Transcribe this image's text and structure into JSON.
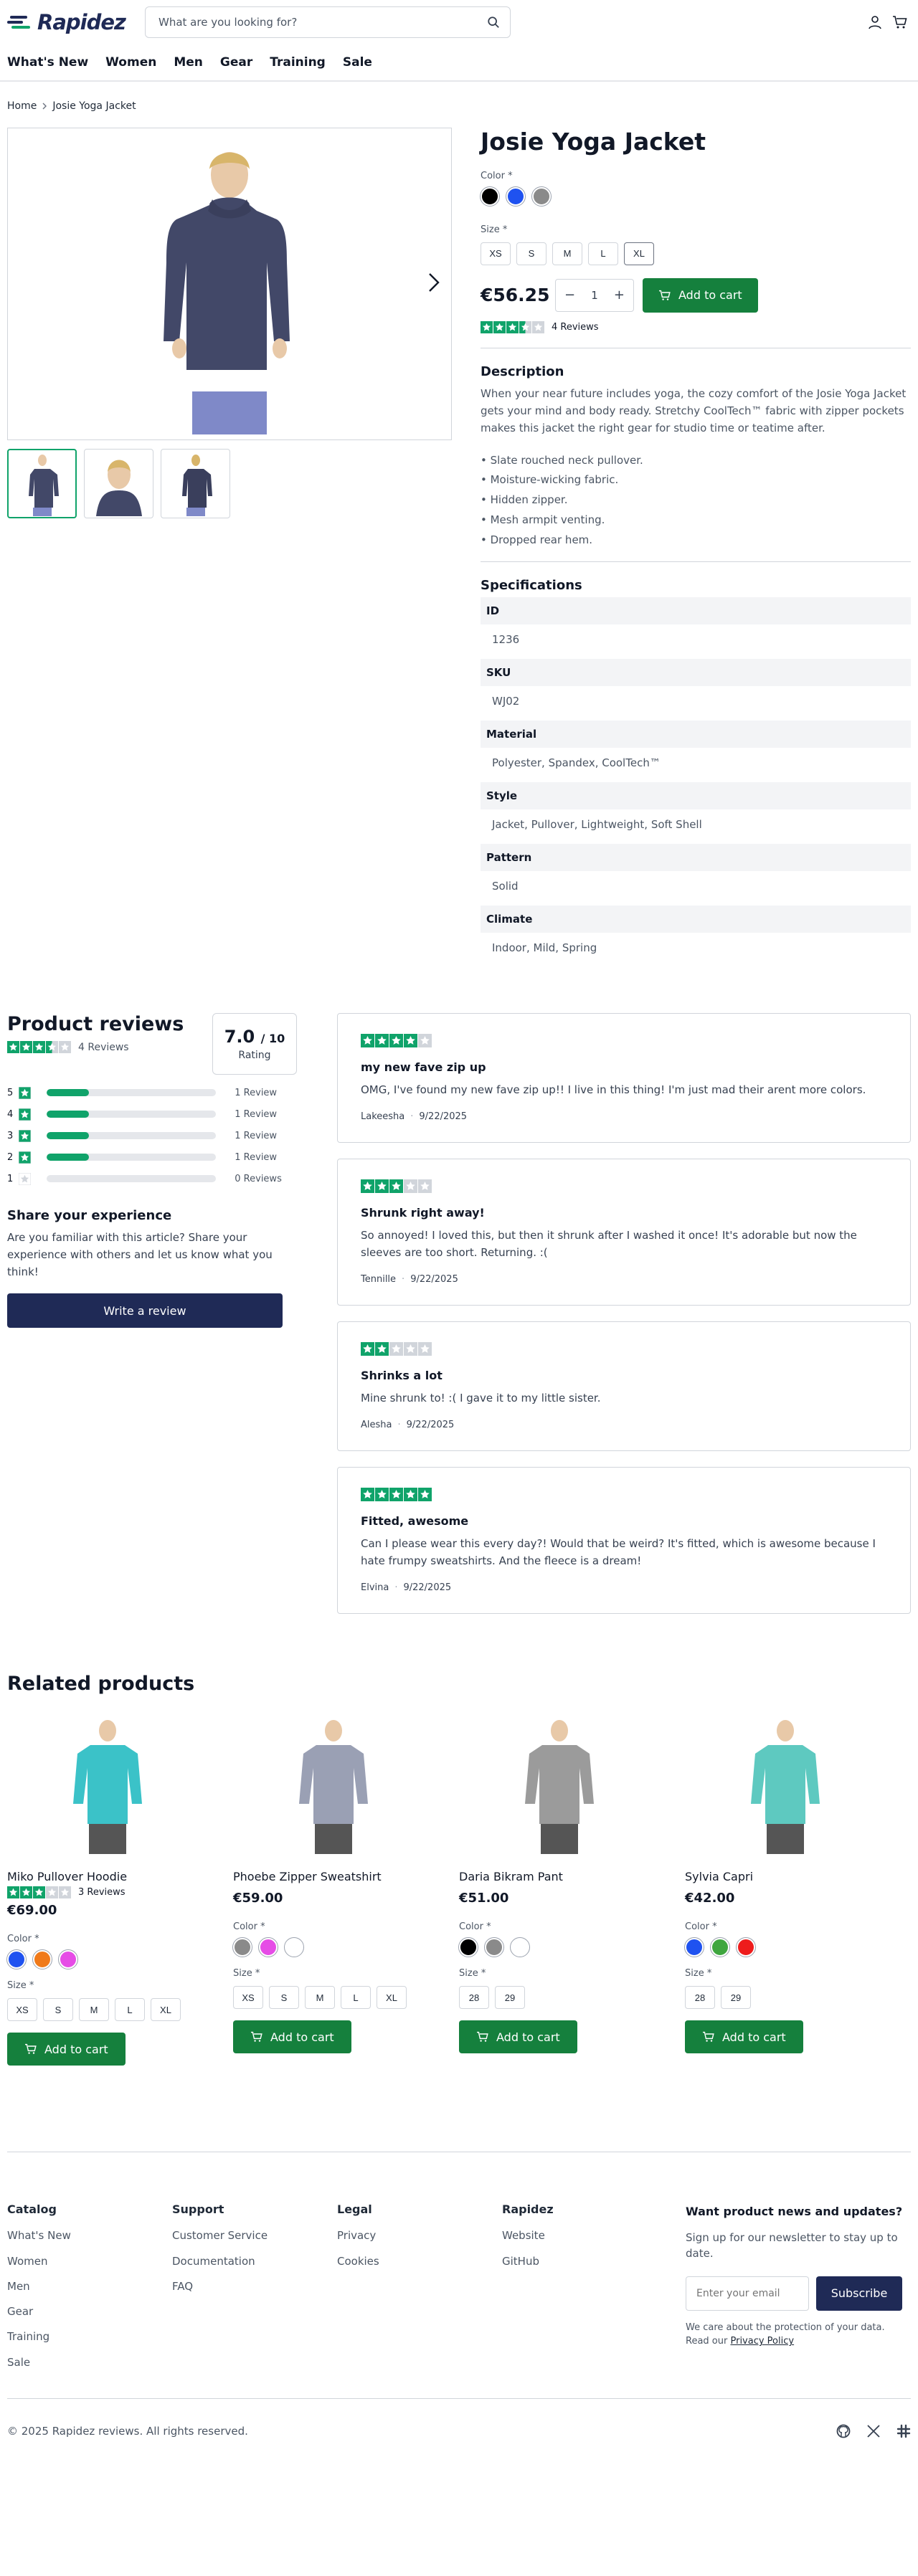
{
  "header": {
    "logo": "Rapidez",
    "search_placeholder": "What are you looking for?",
    "nav": [
      "What's New",
      "Women",
      "Men",
      "Gear",
      "Training",
      "Sale"
    ]
  },
  "breadcrumb": {
    "home": "Home",
    "current": "Josie Yoga Jacket"
  },
  "product": {
    "title": "Josie Yoga Jacket",
    "color_label": "Color *",
    "colors": [
      "#000000",
      "#1f52f0",
      "#8a8a8a"
    ],
    "size_label": "Size *",
    "sizes": [
      "XS",
      "S",
      "M",
      "L",
      "XL"
    ],
    "price": "€56.25",
    "qty": "1",
    "add_to_cart": "Add to cart",
    "rating": 3.5,
    "review_count": "4 Reviews",
    "desc_heading": "Description",
    "description": "When your near future includes yoga, the cozy comfort of the Josie Yoga Jacket gets your mind and body ready. Stretchy CoolTech™ fabric with zipper pockets makes this jacket the right gear for studio time or teatime after.",
    "bullets": [
      "• Slate rouched neck pullover.",
      "• Moisture-wicking fabric.",
      "• Hidden zipper.",
      "• Mesh armpit venting.",
      "• Dropped rear hem."
    ],
    "spec_heading": "Specifications",
    "specs": [
      {
        "k": "ID",
        "v": "1236"
      },
      {
        "k": "SKU",
        "v": "WJ02"
      },
      {
        "k": "Material",
        "v": "Polyester, Spandex, CoolTech™"
      },
      {
        "k": "Style",
        "v": "Jacket, Pullover, Lightweight, Soft Shell"
      },
      {
        "k": "Pattern",
        "v": "Solid"
      },
      {
        "k": "Climate",
        "v": "Indoor, Mild, Spring"
      }
    ]
  },
  "reviews": {
    "heading": "Product reviews",
    "count": "4 Reviews",
    "score": "7.0",
    "score_max": "/ 10",
    "score_label": "Rating",
    "distribution": [
      {
        "star": "5",
        "label": "1 Review",
        "fraction": 0.25
      },
      {
        "star": "4",
        "label": "1 Review",
        "fraction": 0.25
      },
      {
        "star": "3",
        "label": "1 Review",
        "fraction": 0.25
      },
      {
        "star": "2",
        "label": "1 Review",
        "fraction": 0.25
      },
      {
        "star": "1",
        "label": "0 Reviews",
        "fraction": 0
      }
    ],
    "share_heading": "Share your experience",
    "share_text": "Are you familiar with this article? Share your experience with others and let us know what you think!",
    "write_button": "Write a review",
    "items": [
      {
        "stars": 4,
        "title": "my new fave zip up",
        "body": "OMG, I've found my new fave zip up!! I live in this thing! I'm just mad their arent more colors.",
        "author": "Lakeesha",
        "date": "9/22/2025"
      },
      {
        "stars": 3,
        "title": "Shrunk right away!",
        "body": "So annoyed! I loved this, but then it shrunk after I washed it once! It's adorable but now the sleeves are too short. Returning. :(",
        "author": "Tennille",
        "date": "9/22/2025"
      },
      {
        "stars": 2,
        "title": "Shrinks a lot",
        "body": "Mine shrunk to! :( I gave it to my little sister.",
        "author": "Alesha",
        "date": "9/22/2025"
      },
      {
        "stars": 5,
        "title": "Fitted, awesome",
        "body": "Can I please wear this every day?! Would that be weird? It's fitted, which is awesome because I hate frumpy sweatshirts. And the fleece is a dream!",
        "author": "Elvina",
        "date": "9/22/2025"
      }
    ]
  },
  "related": {
    "heading": "Related products",
    "color_label": "Color *",
    "size_label": "Size *",
    "add_to_cart": "Add to cart",
    "items": [
      {
        "name": "Miko Pullover Hoodie",
        "price": "€69.00",
        "rating": 3,
        "reviews": "3 Reviews",
        "colors": [
          "#1f52f0",
          "#f07a1a",
          "#e64ce6"
        ],
        "sizes": [
          "XS",
          "S",
          "M",
          "L",
          "XL"
        ],
        "garment": "#3bc2c8"
      },
      {
        "name": "Phoebe Zipper Sweatshirt",
        "price": "€59.00",
        "colors": [
          "#8a8a8a",
          "#e64ce6",
          "#ffffff"
        ],
        "sizes": [
          "XS",
          "S",
          "M",
          "L",
          "XL"
        ],
        "garment": "#9aa0b4"
      },
      {
        "name": "Daria Bikram Pant",
        "price": "€51.00",
        "colors": [
          "#000000",
          "#8a8a8a",
          "#ffffff"
        ],
        "sizes": [
          "28",
          "29"
        ],
        "garment": "#9b9b9b"
      },
      {
        "name": "Sylvia Capri",
        "price": "€42.00",
        "colors": [
          "#1f52f0",
          "#3fa63f",
          "#ee1c1c"
        ],
        "sizes": [
          "28",
          "29"
        ],
        "garment": "#5ec9c0"
      }
    ]
  },
  "footer": {
    "cols": [
      {
        "title": "Catalog",
        "links": [
          "What's New",
          "Women",
          "Men",
          "Gear",
          "Training",
          "Sale"
        ]
      },
      {
        "title": "Support",
        "links": [
          "Customer Service",
          "Documentation",
          "FAQ"
        ]
      },
      {
        "title": "Legal",
        "links": [
          "Privacy",
          "Cookies"
        ]
      },
      {
        "title": "Rapidez",
        "links": [
          "Website",
          "GitHub"
        ]
      }
    ],
    "news_heading": "Want product news and updates?",
    "news_text": "Sign up for our newsletter to stay up to date.",
    "email_placeholder": "Enter your email",
    "subscribe": "Subscribe",
    "privacy_text": "We care about the protection of your data. Read our",
    "privacy_link": "Privacy Policy",
    "copyright": "© 2025 Rapidez reviews. All rights reserved."
  },
  "colors": {
    "green": "#15803d",
    "star_green": "#10a36a",
    "navy": "#1f2a56"
  }
}
